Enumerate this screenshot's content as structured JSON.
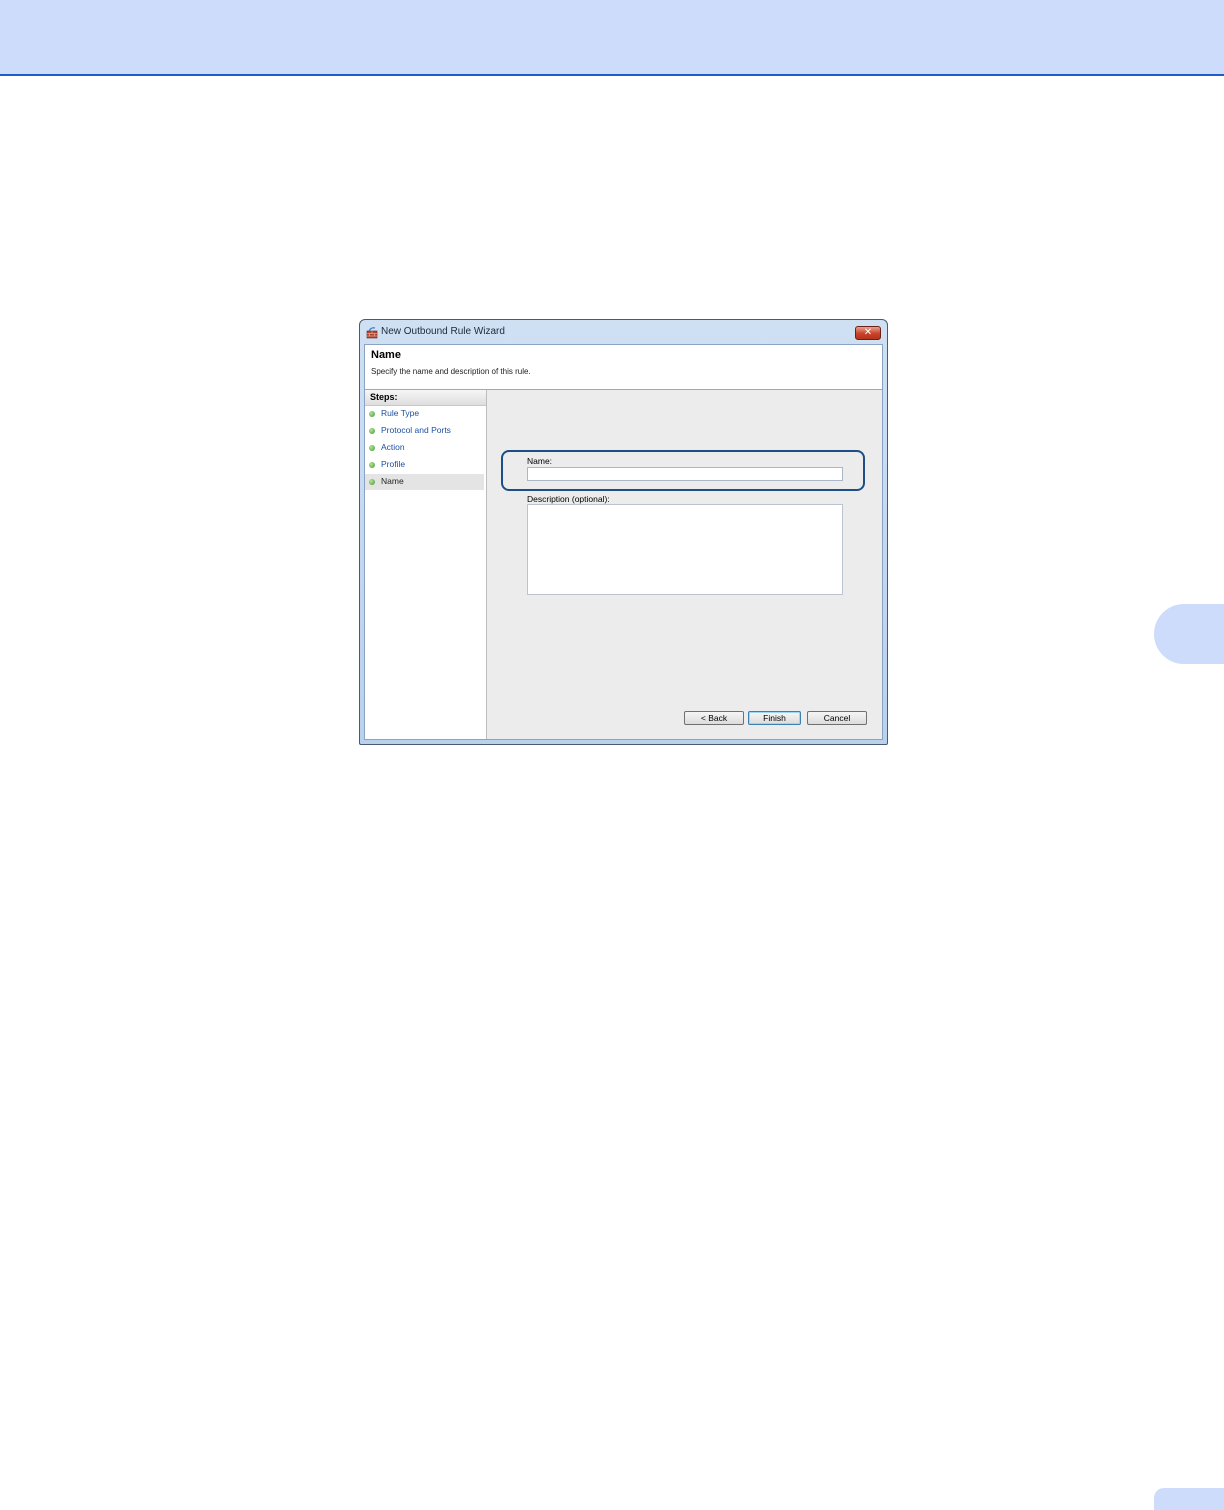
{
  "dialog": {
    "title": "New Outbound Rule Wizard",
    "close_glyph": "✕",
    "heading": "Name",
    "subheading": "Specify the name and description of this rule."
  },
  "steps": {
    "header": "Steps:",
    "items": [
      {
        "label": "Rule Type"
      },
      {
        "label": "Protocol and Ports"
      },
      {
        "label": "Action"
      },
      {
        "label": "Profile"
      },
      {
        "label": "Name"
      }
    ],
    "active_index": 4
  },
  "form": {
    "name_label": "Name:",
    "name_value": "",
    "description_label": "Description (optional):",
    "description_value": ""
  },
  "buttons": {
    "back": "< Back",
    "finish": "Finish",
    "cancel": "Cancel"
  },
  "colors": {
    "page_banner": "#cddcfb",
    "step_dot": "#3d9b2b",
    "step_link": "#1d4fa0",
    "highlight_ring": "#1e4e86"
  }
}
